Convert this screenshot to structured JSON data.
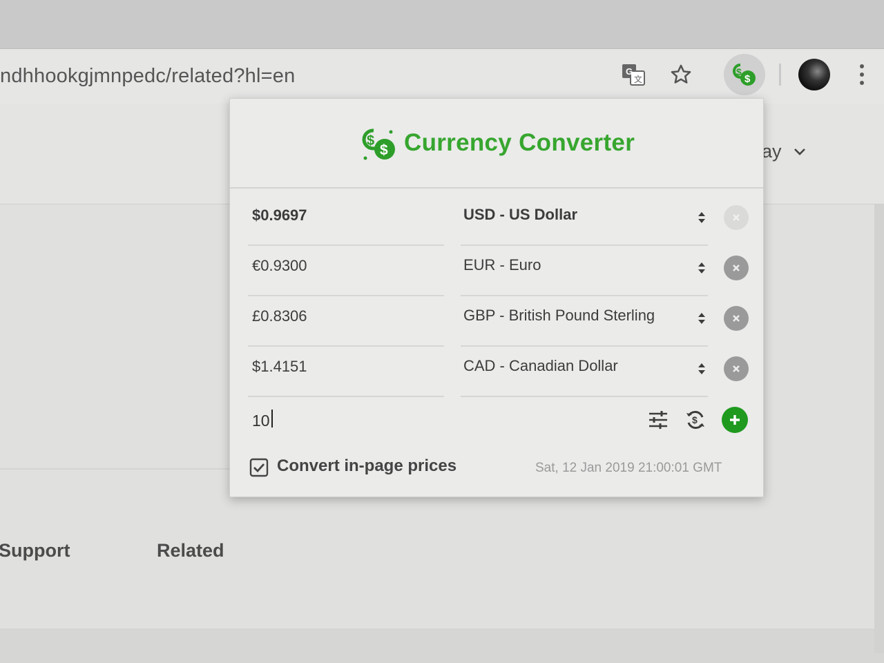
{
  "browser": {
    "url_fragment": "ndhhookgjmnpedc/related?hl=en",
    "icons": [
      "translate-icon",
      "star-icon",
      "currency-converter-extension-icon",
      "profile-avatar",
      "more-vert-icon"
    ]
  },
  "page": {
    "dropdown_partial_label": "ay",
    "tabs": [
      {
        "label": "Support"
      },
      {
        "label": "Related"
      }
    ]
  },
  "popup": {
    "title": "Currency Converter",
    "brand_color": "#37a62f",
    "rows": [
      {
        "value": "$0.9697",
        "currency": "USD - US Dollar",
        "base": true
      },
      {
        "value": "€0.9300",
        "currency": "EUR - Euro",
        "base": false
      },
      {
        "value": "£0.8306",
        "currency": "GBP - British Pound Sterling",
        "base": false
      },
      {
        "value": "$1.4151",
        "currency": "CAD - Canadian Dollar",
        "base": false
      }
    ],
    "amount": "10",
    "convert_in_page_label": "Convert in-page prices",
    "convert_in_page_checked": true,
    "timestamp": "Sat, 12 Jan 2019 21:00:01 GMT"
  }
}
